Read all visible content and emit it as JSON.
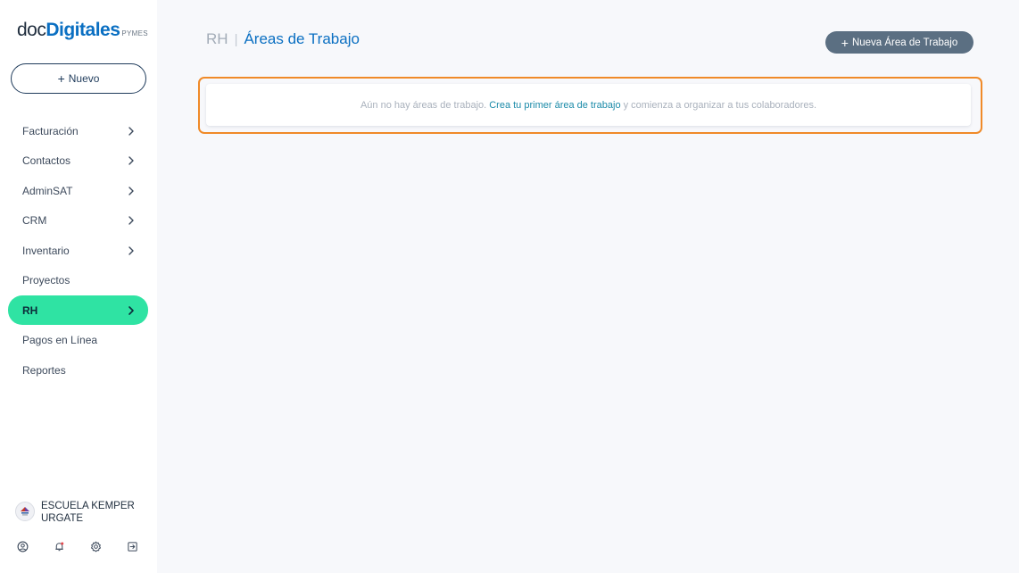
{
  "brand": {
    "part1": "doc",
    "part2": "Digitales",
    "part3": "PYMES"
  },
  "sidebar": {
    "new_button": {
      "icon": "+",
      "label": "Nuevo"
    },
    "items": [
      {
        "label": "Facturación",
        "has_chevron": true
      },
      {
        "label": "Contactos",
        "has_chevron": true
      },
      {
        "label": "AdminSAT",
        "has_chevron": true
      },
      {
        "label": "CRM",
        "has_chevron": true
      },
      {
        "label": "Inventario",
        "has_chevron": true
      },
      {
        "label": "Proyectos",
        "has_chevron": false
      },
      {
        "label": "RH",
        "has_chevron": true,
        "active": true
      },
      {
        "label": "Pagos en Línea",
        "has_chevron": false
      },
      {
        "label": "Reportes",
        "has_chevron": false
      }
    ],
    "company": {
      "name": "ESCUELA KEMPER URGATE"
    },
    "footer_icons": [
      "user-circle-icon",
      "bell-icon",
      "gear-icon",
      "logout-icon"
    ]
  },
  "header": {
    "section": "RH",
    "separator": "|",
    "title": "Áreas de Trabajo",
    "new_area_button": {
      "icon": "+",
      "label": "Nueva Área de Trabajo"
    }
  },
  "empty_state": {
    "text_before": "Aún no hay áreas de trabajo.",
    "link": "Crea tu primer área de trabajo",
    "text_after": "y comienza a organizar a tus colaboradores."
  },
  "colors": {
    "accent": "#2fe3a3",
    "brand_blue": "#0a6fc2",
    "highlight_border": "#f08a28",
    "primary_button": "#5b6f82"
  }
}
